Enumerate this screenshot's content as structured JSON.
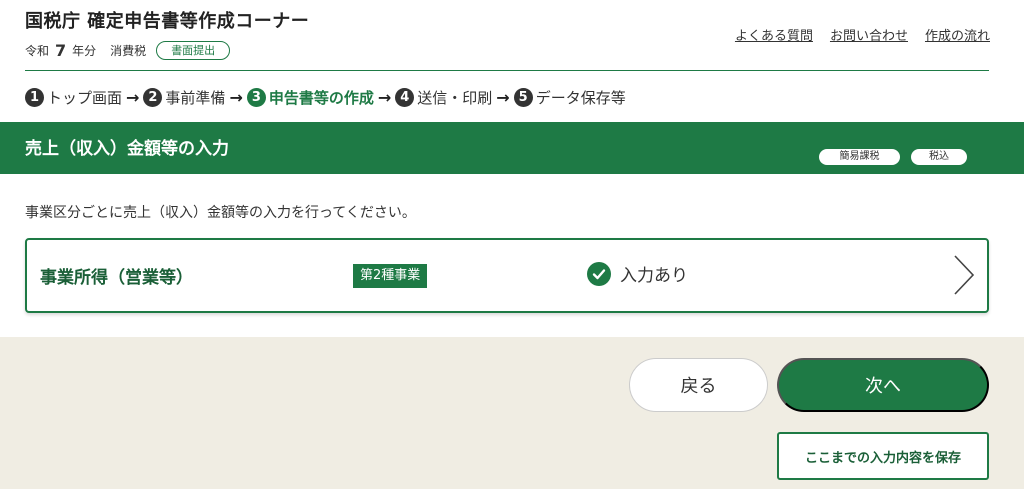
{
  "header": {
    "title": "国税庁 確定申告書等作成コーナー",
    "era_label": "令和",
    "year_number": "7",
    "year_suffix": "年分",
    "tax_type": "消費税",
    "submission_badge": "書面提出",
    "links": [
      "よくある質問",
      "お問い合わせ",
      "作成の流れ"
    ]
  },
  "steps": [
    {
      "num": "1",
      "label": "トップ画面"
    },
    {
      "num": "2",
      "label": "事前準備"
    },
    {
      "num": "3",
      "label": "申告書等の作成"
    },
    {
      "num": "4",
      "label": "送信・印刷"
    },
    {
      "num": "5",
      "label": "データ保存等"
    }
  ],
  "current_step": 3,
  "section": {
    "title": "売上（収入）金額等の入力",
    "tags": [
      "簡易課税",
      "税込"
    ]
  },
  "description": "事業区分ごとに売上（収入）金額等の入力を行ってください。",
  "business": {
    "name": "事業所得（営業等）",
    "category": "第2種事業",
    "status": "入力あり"
  },
  "footer": {
    "back_label": "戻る",
    "next_label": "次へ",
    "save_label": "ここまでの入力内容を保存"
  },
  "colors": {
    "brand_green": "#1e7a45",
    "footer_bg": "#f0ede3"
  },
  "icons": {
    "step_arrow": "arrow-right-icon",
    "status": "check-circle-icon",
    "card": "chevron-right-icon"
  }
}
